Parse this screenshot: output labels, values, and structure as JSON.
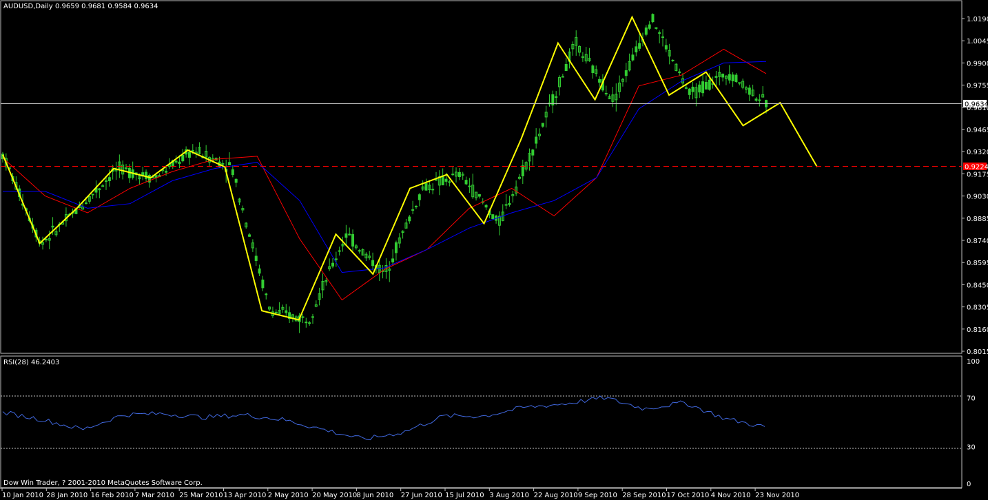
{
  "main_panel": {
    "symbol_label": "AUDUSD,Daily",
    "ohlc_label": "0.9659 0.9681 0.9584 0.9634",
    "y_ticks": [
      "1.0190",
      "1.0045",
      "0.9900",
      "0.9755",
      "0.9610",
      "0.9465",
      "0.9320",
      "0.9175",
      "0.9030",
      "0.8885",
      "0.8740",
      "0.8595",
      "0.8450",
      "0.8305",
      "0.8160",
      "0.8015"
    ],
    "current_price_label": "0.9634",
    "target_price_label": "0.9224"
  },
  "rsi_panel": {
    "label": "RSI(28) 46.2403",
    "y_ticks": [
      "100",
      "70",
      "30",
      "0"
    ]
  },
  "copyright": "Dow Win Trader, ? 2001-2010 MetaQuotes Software Corp.",
  "x_ticks": [
    "10 Jan 2010",
    "28 Jan 2010",
    "16 Feb 2010",
    "7 Mar 2010",
    "25 Mar 2010",
    "13 Apr 2010",
    "2 May 2010",
    "20 May 2010",
    "8 Jun 2010",
    "27 Jun 2010",
    "15 Jul 2010",
    "3 Aug 2010",
    "22 Aug 2010",
    "9 Sep 2010",
    "28 Sep 2010",
    "17 Oct 2010",
    "4 Nov 2010",
    "23 Nov 2010"
  ],
  "colors": {
    "background": "#000000",
    "grid": "#c0c0c0",
    "candles": "#32cd32",
    "zigzag": "#ffff00",
    "ma_fast": "#ff0000",
    "ma_slow": "#0000ff",
    "rsi_line": "#4169e1",
    "current_line": "#c0c0c0",
    "target_line": "#ff0000",
    "target_box": "#ff0000"
  },
  "chart_data": [
    {
      "type": "line",
      "title": "AUDUSD,Daily",
      "ylim": [
        0.8015,
        1.019
      ],
      "x": [
        "10 Jan 2010",
        "28 Jan 2010",
        "16 Feb 2010",
        "7 Mar 2010",
        "25 Mar 2010",
        "13 Apr 2010",
        "2 May 2010",
        "20 May 2010",
        "8 Jun 2010",
        "27 Jun 2010",
        "15 Jul 2010",
        "3 Aug 2010",
        "22 Aug 2010",
        "9 Sep 2010",
        "28 Sep 2010",
        "17 Oct 2010",
        "4 Nov 2010",
        "23 Nov 2010"
      ],
      "series": [
        {
          "name": "",
          "kind": "zigzag",
          "values": [
            0.93,
            0.872,
            0.895,
            0.921,
            0.915,
            0.933,
            0.922,
            0.828,
            0.822,
            0.878,
            0.852,
            0.908,
            0.917,
            0.885,
            0.94,
            1.003,
            0.966,
            1.02,
            0.969,
            0.984,
            0.949,
            0.964,
            0.922
          ]
        },
        {
          "name": "",
          "kind": "ma_fast",
          "values": [
            0.928,
            0.903,
            0.892,
            0.908,
            0.919,
            0.927,
            0.929,
            0.875,
            0.835,
            0.855,
            0.868,
            0.895,
            0.908,
            0.89,
            0.915,
            0.975,
            0.982,
            0.999,
            0.983
          ]
        },
        {
          "name": "",
          "kind": "ma_slow",
          "values": [
            0.906,
            0.906,
            0.895,
            0.898,
            0.913,
            0.921,
            0.925,
            0.9,
            0.853,
            0.856,
            0.868,
            0.882,
            0.892,
            0.9,
            0.915,
            0.96,
            0.978,
            0.99,
            0.991
          ]
        }
      ],
      "current_price": 0.9634,
      "target_price": 0.9224
    },
    {
      "type": "line",
      "title": "RSI(28) 46.2403",
      "ylim": [
        0,
        100
      ],
      "series": [
        {
          "name": "",
          "values": [
            58,
            52,
            44,
            56,
            57,
            54,
            56,
            52,
            44,
            36,
            42,
            55,
            55,
            62,
            65,
            70,
            61,
            66,
            53,
            46
          ]
        }
      ],
      "levels": [
        70,
        30
      ]
    }
  ]
}
